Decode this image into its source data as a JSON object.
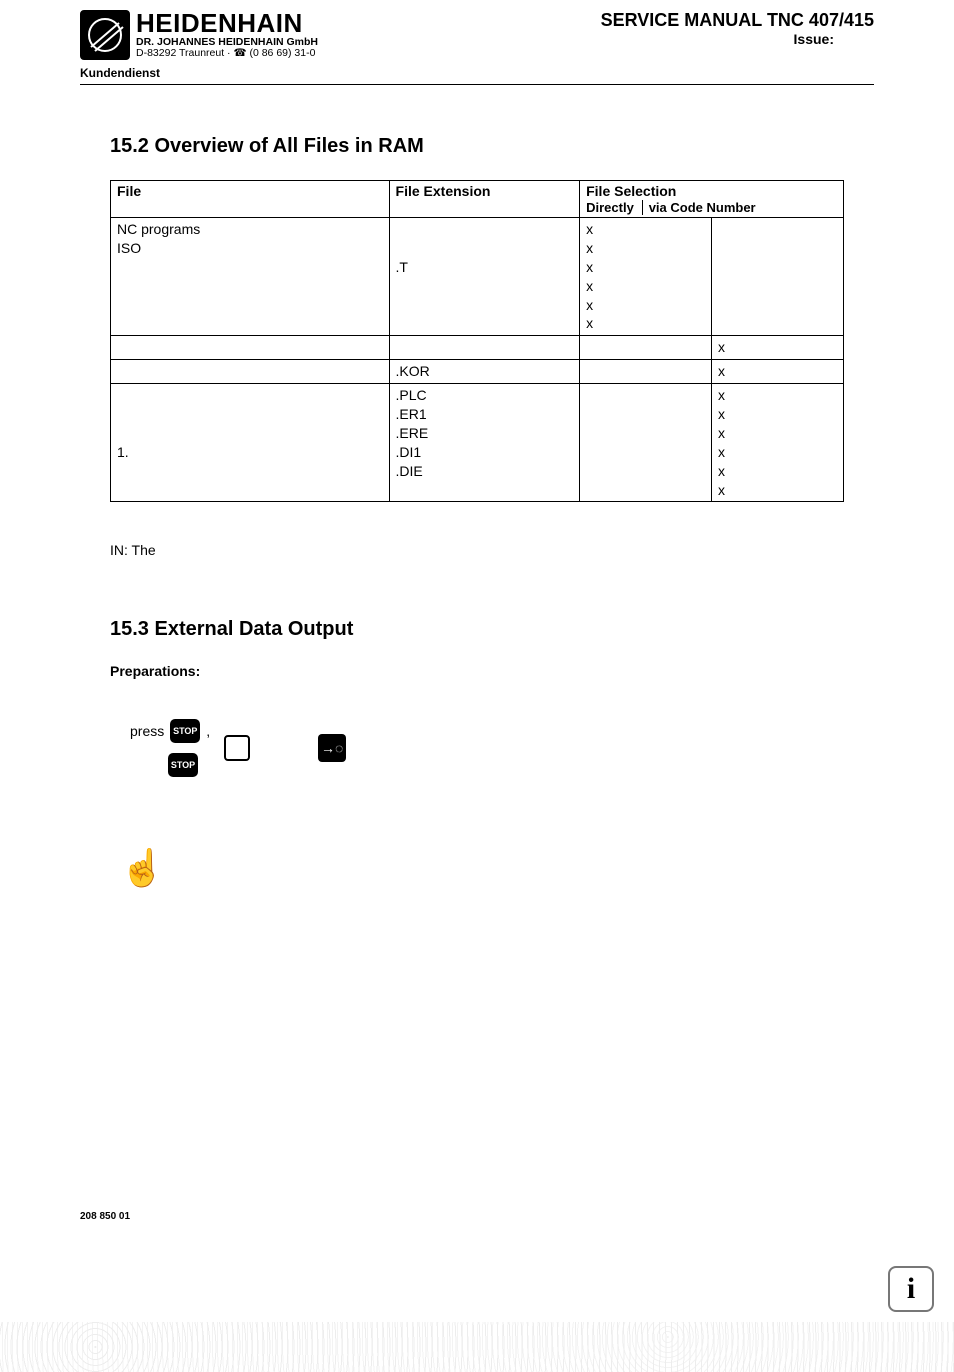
{
  "header": {
    "brand": "HEIDENHAIN",
    "company": "DR. JOHANNES HEIDENHAIN GmbH",
    "address": "D-83292 Traunreut · ☎ (0 86 69) 31-0",
    "manual_title": "SERVICE MANUAL TNC 407/415",
    "issue_label": "Issue:",
    "kundendienst": "Kundendienst"
  },
  "section_15_2": {
    "title": "15.2 Overview of All Files in RAM",
    "table": {
      "headers": {
        "file": "File",
        "extension": "File  Extension",
        "selection_group": "File Selection",
        "directly": "Directly",
        "via_code": "via Code Number"
      },
      "groups": [
        {
          "file_lines": [
            "NC programs",
            "ISO",
            "",
            "",
            "",
            ""
          ],
          "ext_lines": [
            "",
            "",
            ".T",
            "",
            "",
            ""
          ],
          "directly": [
            "x",
            "x",
            "x",
            "x",
            "x",
            "x"
          ],
          "via_code": [
            "",
            "",
            "",
            "",
            "",
            ""
          ]
        },
        {
          "file_lines": [
            ""
          ],
          "ext_lines": [
            ""
          ],
          "directly": [
            ""
          ],
          "via_code": [
            "x"
          ]
        },
        {
          "file_lines": [
            ""
          ],
          "ext_lines": [
            ".KOR"
          ],
          "directly": [
            ""
          ],
          "via_code": [
            "x"
          ]
        },
        {
          "file_lines": [
            "",
            "",
            "",
            "1.",
            "",
            ""
          ],
          "ext_lines": [
            ".PLC",
            ".ER1",
            ".ERE",
            ".DI1",
            ".DIE",
            ""
          ],
          "directly": [
            "",
            "",
            "",
            "",
            "",
            ""
          ],
          "via_code": [
            "x",
            "x",
            "x",
            "x",
            "x",
            "x"
          ]
        }
      ]
    },
    "note": "IN: The"
  },
  "section_15_3": {
    "title": "15.3  External  Data  Output",
    "prep_label": "Preparations:",
    "press_label": "press",
    "stop_label": "STOP",
    "send_glyph": "→◌"
  },
  "footer": {
    "doc_num": "208 850 01",
    "info_glyph": "i"
  }
}
